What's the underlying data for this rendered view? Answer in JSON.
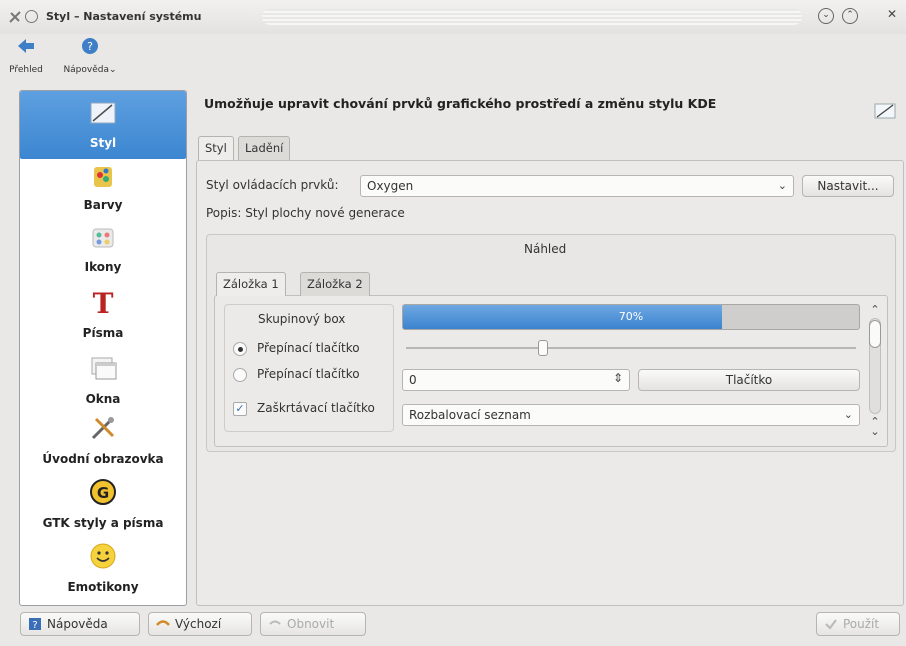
{
  "window": {
    "title": "Styl – Nastavení systému"
  },
  "toolbar": {
    "overview_label": "Přehled",
    "help_label": "Nápověda"
  },
  "categories": [
    {
      "label": "Styl",
      "icon": "style-icon",
      "selected": true
    },
    {
      "label": "Barvy",
      "icon": "colors-icon"
    },
    {
      "label": "Ikony",
      "icon": "icons-icon"
    },
    {
      "label": "Písma",
      "icon": "fonts-icon"
    },
    {
      "label": "Okna",
      "icon": "windows-icon"
    },
    {
      "label": "Úvodní obrazovka",
      "icon": "splash-icon"
    },
    {
      "label": "GTK styly a písma",
      "icon": "gtk-icon"
    },
    {
      "label": "Emotikony",
      "icon": "emoticons-icon"
    }
  ],
  "main": {
    "heading": "Umožňuje upravit chování prvků grafického prostředí a změnu stylu KDE",
    "tabs": [
      {
        "label": "Styl"
      },
      {
        "label": "Ladění"
      }
    ],
    "widget_style_label": "Styl ovládacích prvků:",
    "widget_style_value": "Oxygen",
    "configure_button": "Nastavit...",
    "description": "Popis: Styl plochy nové generace",
    "preview": {
      "title": "Náhled",
      "tabs": [
        {
          "label": "Záložka 1"
        },
        {
          "label": "Záložka 2"
        }
      ],
      "groupbox_title": "Skupinový box",
      "radio1": "Přepínací tlačítko",
      "radio2": "Přepínací tlačítko",
      "checkbox": "Zaškrtávací tlačítko",
      "progress_value": 70,
      "progress_text": "70%",
      "slider_value": 0.3,
      "spin_value": "0",
      "button_label": "Tlačítko",
      "combo_value": "Rozbalovací seznam"
    }
  },
  "footer": {
    "help": "Nápověda",
    "defaults": "Výchozí",
    "reset": "Obnovit",
    "apply": "Použít"
  },
  "colors": {
    "selection": "#3c86d1",
    "progress": "#4a90da"
  }
}
